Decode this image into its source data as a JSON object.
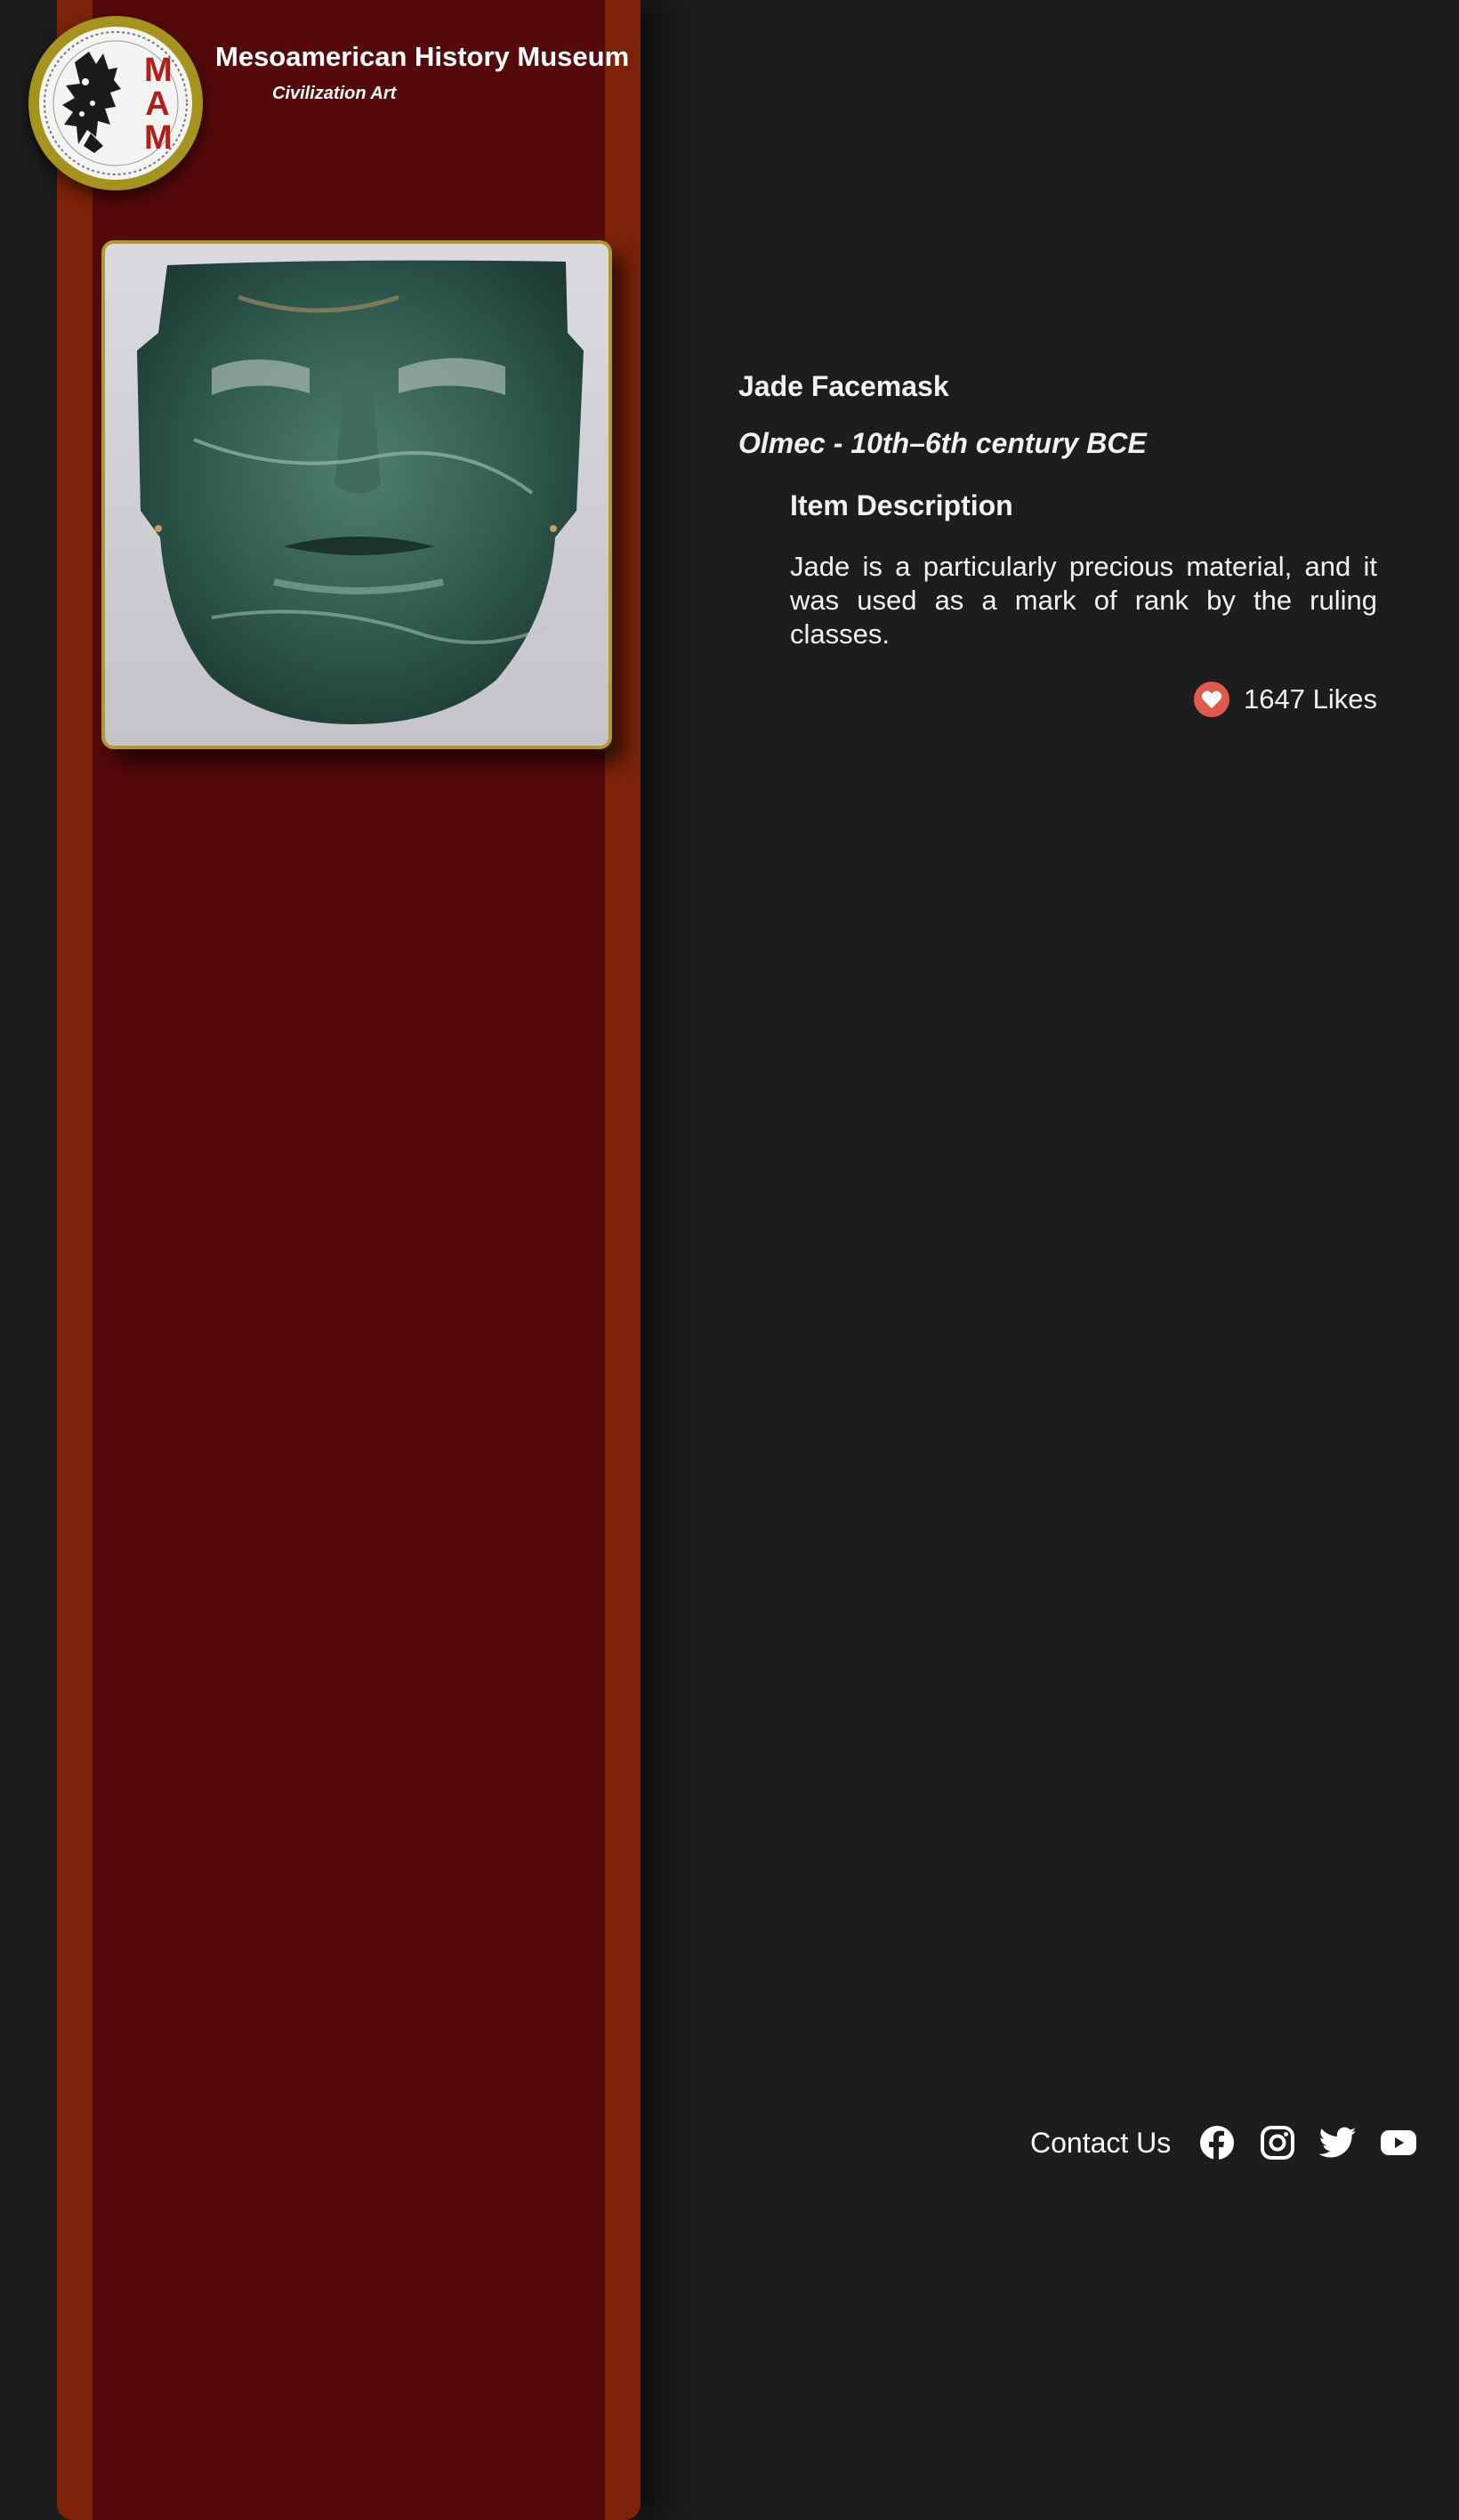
{
  "header": {
    "museum_title": "Mesoamerican History Museum",
    "museum_subtitle": "Civilization Art",
    "logo_text": "MAM"
  },
  "item": {
    "title": "Jade Facemask",
    "origin": "Olmec - 10th–6th century BCE",
    "description_heading": "Item Description",
    "description": "Jade is a particularly precious material, and it was used as a mark of rank by the ruling classes.",
    "likes_label": "1647 Likes"
  },
  "footer": {
    "contact_label": "Contact Us",
    "social_icons": [
      "facebook-icon",
      "instagram-icon",
      "twitter-icon",
      "youtube-icon"
    ]
  },
  "colors": {
    "background": "#1d1d1f",
    "sidebar_outer": "#7c230a",
    "sidebar_inner": "#55090a",
    "gold_border": "#b19a2c",
    "like_red": "#e05a4c",
    "logo_red": "#b01f1a"
  }
}
